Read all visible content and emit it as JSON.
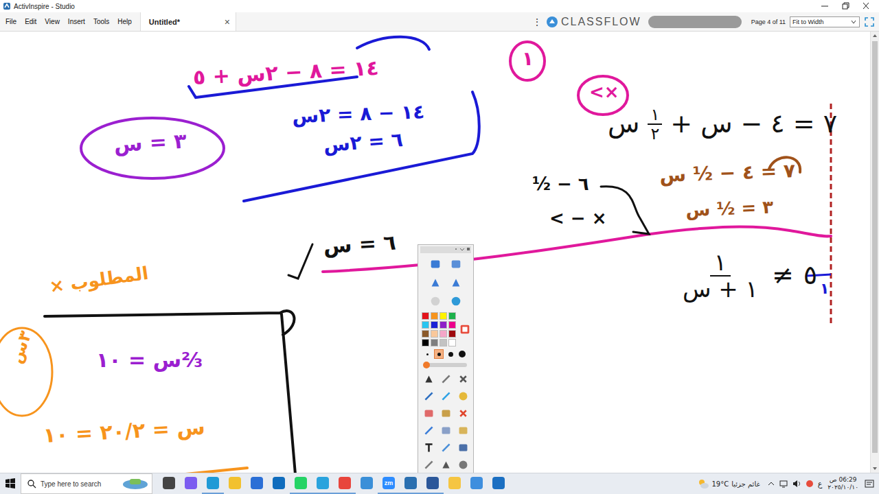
{
  "window": {
    "title": "ActivInspire - Studio"
  },
  "menus": [
    "File",
    "Edit",
    "View",
    "Insert",
    "Tools",
    "Help"
  ],
  "tab": {
    "label": "Untitled*",
    "close": "×"
  },
  "toolbar": {
    "more": "⋮",
    "brand": "CLASSFLOW",
    "page": "Page 4 of 11",
    "zoom": "Fit to Width"
  },
  "equations": [
    {
      "tokens": [
        {
          "kind": "text",
          "text": "س"
        },
        {
          "kind": "fraction",
          "num": "١",
          "den": "٢"
        },
        {
          "kind": "text",
          "text": "+"
        },
        {
          "kind": "text",
          "text": "س"
        },
        {
          "kind": "text",
          "text": "−"
        },
        {
          "kind": "text",
          "text": "٤"
        },
        {
          "kind": "text",
          "text": "="
        },
        {
          "kind": "text",
          "text": "٧"
        }
      ]
    },
    {
      "tokens": [
        {
          "kind": "fraction",
          "num": "١",
          "den": "١ + س"
        },
        {
          "kind": "text",
          "text": "≠"
        },
        {
          "kind": "text",
          "text": "٥"
        }
      ]
    }
  ],
  "ink": [
    {
      "text": "١٤ = ٨ − ٢س + ٥",
      "color": "#e0189c"
    },
    {
      "text": "١٤ − ٨ = ٢س",
      "color": "#1a1ad6"
    },
    {
      "text": "٦ = ٢س",
      "color": "#1a1ad6"
    },
    {
      "text": "٣ = س",
      "color": "#9b1fd0"
    },
    {
      "text": "١",
      "color": "#e0189c"
    },
    {
      "text": "<×",
      "color": "#e0189c"
    },
    {
      "text": "٧ = ٤ − ½ س",
      "color": "#a0521a"
    },
    {
      "text": "٣ = ½ س",
      "color": "#a0521a"
    },
    {
      "text": "½ − ٦",
      "color": "#111111"
    },
    {
      "text": "< − ×",
      "color": "#111111"
    },
    {
      "text": "٦ = س",
      "color": "#111111"
    },
    {
      "text": "المطلوب ×",
      "color": "#f7941d"
    },
    {
      "text": "٣س",
      "color": "#f7941d"
    },
    {
      "text": "⅔س = ١٠",
      "color": "#9b1fd0"
    },
    {
      "text": "س = ٢٠/٢ = ١٠",
      "color": "#f7941d"
    },
    {
      "text": "١",
      "color": "#1a1ad6"
    }
  ],
  "toolbox": {
    "tools_top": [
      {
        "kind": "pages",
        "disabled": false
      },
      {
        "kind": "screen",
        "disabled": false
      },
      {
        "kind": "back",
        "disabled": false
      },
      {
        "kind": "forward",
        "disabled": false
      },
      {
        "kind": "play",
        "disabled": true
      },
      {
        "kind": "globe",
        "disabled": false
      }
    ],
    "palette": [
      {
        "color": "#e3131b"
      },
      {
        "color": "#f7941d"
      },
      {
        "color": "#fff200"
      },
      {
        "color": "#1db14b"
      },
      {
        "color": "#29c5f0"
      },
      {
        "color": "#1b22d6"
      },
      {
        "color": "#8e20c8"
      },
      {
        "color": "#ec008c"
      },
      {
        "color": "#8b5a2b"
      },
      {
        "color": "#f9c89b"
      },
      {
        "color": "#f4a6c8"
      },
      {
        "color": "#9e0b0f"
      },
      {
        "color": "#000000"
      },
      {
        "color": "#7f7f7f"
      },
      {
        "color": "#c3c3c3"
      },
      {
        "color": "#ffffff"
      }
    ],
    "widths": [
      {
        "selected": false
      },
      {
        "selected": true
      },
      {
        "selected": false
      },
      {
        "selected": false
      }
    ],
    "thickness": {
      "level": 0.05
    },
    "tools_bottom": [
      {
        "kind": "select",
        "disabled": false
      },
      {
        "kind": "wand",
        "disabled": false
      },
      {
        "kind": "clip",
        "disabled": false
      },
      {
        "kind": "pen",
        "disabled": false
      },
      {
        "kind": "highlighter",
        "disabled": false
      },
      {
        "kind": "spotlight",
        "disabled": false
      },
      {
        "kind": "eraser",
        "disabled": false
      },
      {
        "kind": "fill",
        "disabled": false
      },
      {
        "kind": "delete",
        "disabled": false
      },
      {
        "kind": "marker",
        "disabled": false
      },
      {
        "kind": "shape",
        "disabled": false
      },
      {
        "kind": "notes",
        "disabled": false
      },
      {
        "kind": "text",
        "disabled": false
      },
      {
        "kind": "link",
        "disabled": false
      },
      {
        "kind": "camera",
        "disabled": false
      },
      {
        "kind": "connector",
        "disabled": false
      },
      {
        "kind": "undo",
        "disabled": false
      },
      {
        "kind": "more",
        "disabled": false
      }
    ]
  },
  "taskbar": {
    "search": "Type here to search",
    "apps": [
      {
        "kind": "taskview",
        "running": false
      },
      {
        "kind": "copilot",
        "running": false
      },
      {
        "kind": "edge",
        "running": true
      },
      {
        "kind": "explorer",
        "running": false
      },
      {
        "kind": "store",
        "running": false
      },
      {
        "kind": "outlook",
        "running": false
      },
      {
        "kind": "whatsapp",
        "running": true
      },
      {
        "kind": "telegram",
        "running": true
      },
      {
        "kind": "chrome",
        "running": true
      },
      {
        "kind": "photos",
        "running": false
      },
      {
        "kind": "zoom",
        "label": "zm",
        "running": true
      },
      {
        "kind": "activinspire",
        "running": true
      },
      {
        "kind": "word",
        "running": true
      },
      {
        "kind": "sticky",
        "running": false
      },
      {
        "kind": "files",
        "running": false
      },
      {
        "kind": "media",
        "running": false
      }
    ],
    "weather": {
      "temp": "19°C",
      "text": "غائم جزئيا"
    },
    "lang": "ع",
    "ampm": "ص",
    "time": "06:29",
    "date": "٢٠٢٥/١٠/١٠"
  }
}
